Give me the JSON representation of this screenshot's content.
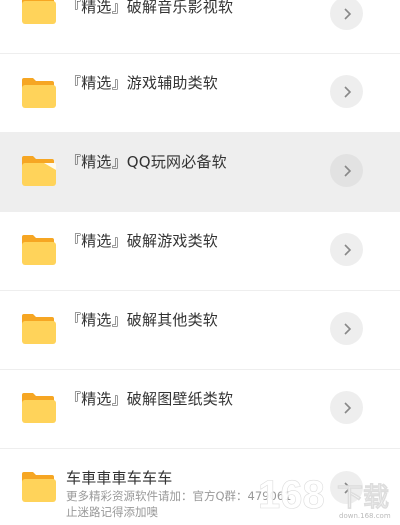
{
  "items": [
    {
      "label": "『精选』破解音乐影视软",
      "highlighted": false
    },
    {
      "label": "『精选』游戏辅助类软",
      "highlighted": false
    },
    {
      "label": "『精选』QQ玩网必备软",
      "highlighted": true
    },
    {
      "label": "『精选』破解游戏类软",
      "highlighted": false
    },
    {
      "label": "『精选』破解其他类软",
      "highlighted": false
    },
    {
      "label": "『精选』破解图壁纸类软",
      "highlighted": false
    },
    {
      "label": "车車車車车车车",
      "highlighted": false
    }
  ],
  "footer": {
    "note_line1": "更多精彩资源软件请加：官方Q群：479061",
    "note_line2": "止迷路记得添加噢"
  },
  "watermark": {
    "brand": "168",
    "suffix": "下载",
    "site": "down.168.com"
  },
  "colors": {
    "folder_back": "#F6A623",
    "folder_front": "#FFD35A",
    "divider": "#EEEEEE",
    "highlight_bg": "#EEEEEE",
    "chevron_bg": "#EEEEEE",
    "chevron_stroke": "#888888"
  },
  "icons": {
    "folder": "folder-icon",
    "chevron": "chevron-right-icon"
  }
}
